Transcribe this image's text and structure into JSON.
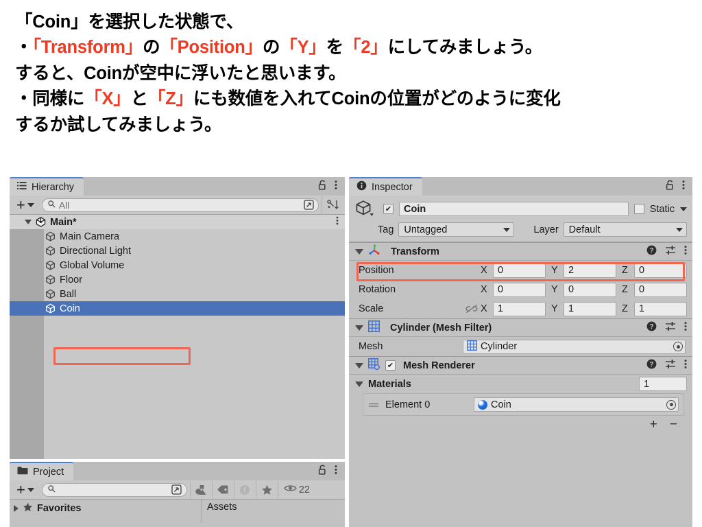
{
  "instructions": {
    "lines": [
      [
        {
          "t": "「Coin」を選択した状態で、",
          "c": "black"
        }
      ],
      [
        {
          "t": "・",
          "c": "black"
        },
        {
          "t": "「Transform」",
          "c": "red"
        },
        {
          "t": "の",
          "c": "black"
        },
        {
          "t": "「Position」",
          "c": "red"
        },
        {
          "t": "の",
          "c": "black"
        },
        {
          "t": "「Y」",
          "c": "red"
        },
        {
          "t": "を",
          "c": "black"
        },
        {
          "t": "「2」",
          "c": "red"
        },
        {
          "t": "にしてみましょう。",
          "c": "black"
        }
      ],
      [
        {
          "t": "すると、Coinが空中に浮いたと思います。",
          "c": "black"
        }
      ],
      [
        {
          "t": "・同様に",
          "c": "black"
        },
        {
          "t": "「X」",
          "c": "red"
        },
        {
          "t": "と",
          "c": "black"
        },
        {
          "t": "「Z」",
          "c": "red"
        },
        {
          "t": "にも数値を入れてCoinの位置がどのように変化",
          "c": "black"
        }
      ],
      [
        {
          "t": "するか試してみましょう。",
          "c": "black"
        }
      ]
    ],
    "accent_color": "#ee3b24"
  },
  "hierarchy": {
    "tab_label": "Hierarchy",
    "tab_icon": "list-icon",
    "lock_icon": "lock-open-icon",
    "menu_icon": "kebab-menu-icon",
    "toolbar": {
      "add_label": "+",
      "search_placeholder": "All",
      "search_value": "",
      "search_icon": "search-icon",
      "expand_icon": "expand-window-icon",
      "sort_icon": "sort-alphabetical-icon"
    },
    "scene_row": {
      "label": "Main*",
      "icon": "unity-scene-icon"
    },
    "items": [
      {
        "label": "Main Camera",
        "icon": "gameobject-cube-icon",
        "selected": false
      },
      {
        "label": "Directional Light",
        "icon": "gameobject-cube-icon",
        "selected": false
      },
      {
        "label": "Global Volume",
        "icon": "gameobject-cube-icon",
        "selected": false
      },
      {
        "label": "Floor",
        "icon": "gameobject-cube-icon",
        "selected": false
      },
      {
        "label": "Ball",
        "icon": "gameobject-cube-icon",
        "selected": false
      },
      {
        "label": "Coin",
        "icon": "gameobject-cube-icon",
        "selected": true
      }
    ],
    "selection_color": "#4a72b8",
    "highlight_color": "#f26552"
  },
  "project": {
    "tab_label": "Project",
    "tab_icon": "folder-icon",
    "lock_icon": "lock-open-icon",
    "menu_icon": "kebab-menu-icon",
    "toolbar": {
      "add_label": "+",
      "search_placeholder": "",
      "search_value": "",
      "search_icon": "search-icon",
      "expand_icon": "expand-window-icon",
      "shapes_icon": "asset-type-filter-icon",
      "label_icon": "tag-icon",
      "warning_icon": "warning-icon",
      "favorite_icon": "star-icon",
      "visibility_icon": "eye-icon",
      "visibility_count": "22"
    },
    "tree": {
      "favorites_label": "Favorites",
      "assets_label": "Assets"
    }
  },
  "inspector": {
    "tab_label": "Inspector",
    "tab_icon": "info-icon",
    "lock_icon": "lock-open-icon",
    "menu_icon": "kebab-menu-icon",
    "object": {
      "icon": "gameobject-cube-icon",
      "enabled": true,
      "name": "Coin",
      "static_label": "Static",
      "static_checked": false,
      "tag_label": "Tag",
      "tag_value": "Untagged",
      "layer_label": "Layer",
      "layer_value": "Default"
    },
    "components": [
      {
        "title": "Transform",
        "icon": "transform-axis-icon",
        "help_icon": "help-icon",
        "preset_icon": "preset-sliders-icon",
        "menu_icon": "kebab-menu-icon",
        "highlighted_row": "Position",
        "rows": [
          {
            "label": "Position",
            "x": "0",
            "y": "2",
            "z": "0",
            "link_icon": null
          },
          {
            "label": "Rotation",
            "x": "0",
            "y": "0",
            "z": "0",
            "link_icon": null
          },
          {
            "label": "Scale",
            "x": "1",
            "y": "1",
            "z": "1",
            "link_icon": "broken-link-icon"
          }
        ],
        "axis_labels": [
          "X",
          "Y",
          "Z"
        ]
      },
      {
        "title": "Cylinder (Mesh Filter)",
        "icon": "mesh-filter-grid-icon",
        "help_icon": "help-icon",
        "preset_icon": "preset-sliders-icon",
        "menu_icon": "kebab-menu-icon",
        "mesh_label": "Mesh",
        "mesh_value": "Cylinder",
        "mesh_value_icon": "mesh-grid-icon",
        "picker_icon": "object-picker-icon"
      },
      {
        "title": "Mesh Renderer",
        "icon": "mesh-renderer-icon",
        "enabled": true,
        "help_icon": "help-icon",
        "preset_icon": "preset-sliders-icon",
        "menu_icon": "kebab-menu-icon",
        "materials_label": "Materials",
        "materials_count": "1",
        "element_label": "Element 0",
        "element_value": "Coin",
        "element_value_icon": "material-sphere-icon",
        "picker_icon": "object-picker-icon",
        "add_label": "+",
        "remove_label": "−"
      }
    ]
  }
}
